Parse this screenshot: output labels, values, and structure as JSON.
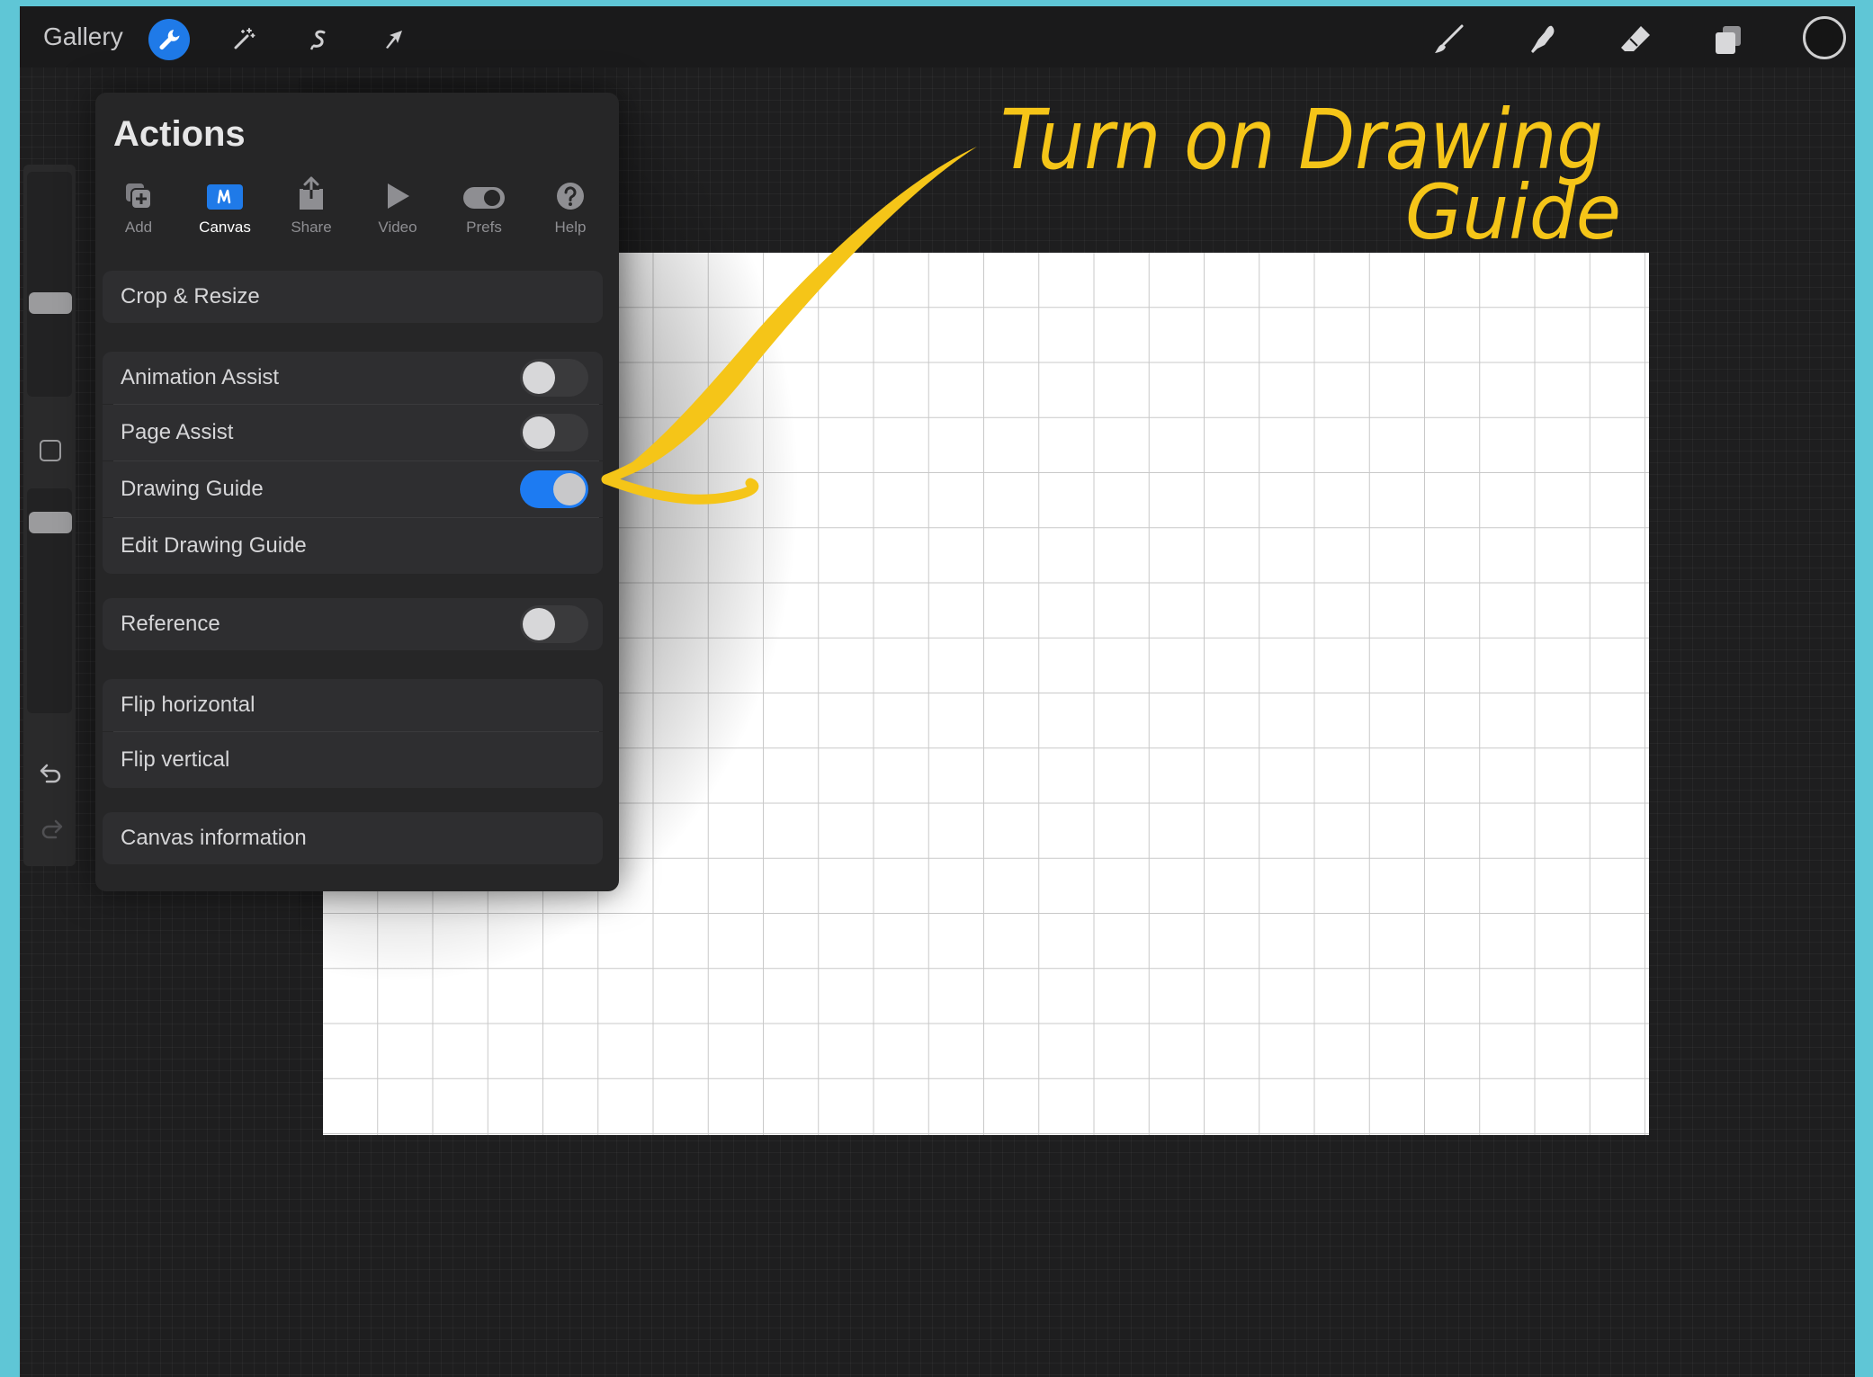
{
  "topbar": {
    "gallery_label": "Gallery",
    "left_tools": [
      "wrench-icon",
      "magic-wand-icon",
      "selection-icon",
      "transform-arrow-icon"
    ],
    "active_tool": "wrench-icon",
    "right_tools": [
      "brush-icon",
      "smudge-icon",
      "eraser-icon",
      "layers-icon",
      "color-well"
    ]
  },
  "sidebar": {
    "items": [
      "brush-size-slider",
      "modify-button",
      "opacity-slider",
      "undo-icon",
      "redo-icon"
    ]
  },
  "actions_panel": {
    "title": "Actions",
    "tabs": [
      {
        "label": "Add",
        "icon": "add-icon"
      },
      {
        "label": "Canvas",
        "icon": "canvas-icon"
      },
      {
        "label": "Share",
        "icon": "share-icon"
      },
      {
        "label": "Video",
        "icon": "video-icon"
      },
      {
        "label": "Prefs",
        "icon": "prefs-icon"
      },
      {
        "label": "Help",
        "icon": "help-icon"
      }
    ],
    "active_tab": "Canvas",
    "rows": {
      "crop_resize": "Crop & Resize",
      "animation_assist": "Animation Assist",
      "page_assist": "Page Assist",
      "drawing_guide": "Drawing Guide",
      "edit_drawing_guide": "Edit Drawing Guide",
      "reference": "Reference",
      "flip_horizontal": "Flip horizontal",
      "flip_vertical": "Flip vertical",
      "canvas_information": "Canvas information"
    },
    "toggles": {
      "animation_assist": false,
      "page_assist": false,
      "drawing_guide": true,
      "reference": false
    }
  },
  "annotation": {
    "line1": "Turn on Drawing",
    "line2": "Guide",
    "color": "#f5c518"
  },
  "colors": {
    "accent": "#1d7bf2",
    "frame": "#5fc6d6",
    "background": "#1e1e1f",
    "panel": "#262627"
  }
}
